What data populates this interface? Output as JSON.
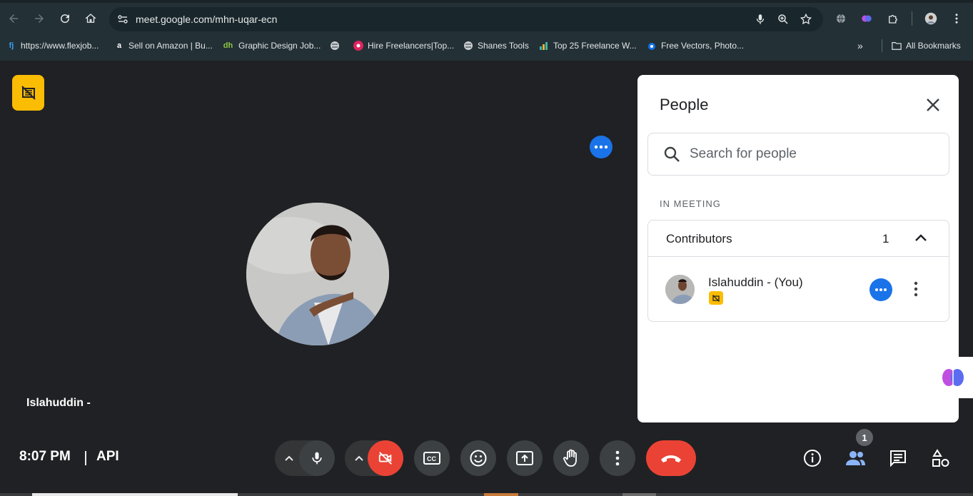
{
  "browser": {
    "url": "meet.google.com/mhn-uqar-ecn",
    "bookmarks": [
      {
        "label": "https://www.flexjob...",
        "icon": "flexjobs-icon"
      },
      {
        "label": "Sell on Amazon | Bu...",
        "icon": "amazon-icon"
      },
      {
        "label": "Graphic Design Job...",
        "icon": "dh-icon"
      },
      {
        "label": "",
        "icon": "globe-icon"
      },
      {
        "label": "Hire Freelancers|Top...",
        "icon": "freelancer-icon"
      },
      {
        "label": "Shanes Tools",
        "icon": "globe-icon"
      },
      {
        "label": "Top 25 Freelance W...",
        "icon": "chart-icon"
      },
      {
        "label": "Free Vectors, Photo...",
        "icon": "freepik-icon"
      }
    ],
    "all_bookmarks": "All Bookmarks"
  },
  "stage": {
    "participant_name": "Islahuddin -"
  },
  "panel": {
    "title": "People",
    "search_placeholder": "Search for people",
    "section_label": "IN MEETING",
    "group_label": "Contributors",
    "group_count": "1",
    "person_name": "Islahuddin - (You)"
  },
  "bottom_bar": {
    "time": "8:07 PM",
    "meeting_code": "API",
    "people_badge": "1"
  },
  "colors": {
    "accent_blue": "#1a73e8",
    "end_call_red": "#ea4335",
    "camera_off_red": "#ea4335",
    "badge_yellow": "#fbbc04",
    "stage_bg": "#202124"
  }
}
